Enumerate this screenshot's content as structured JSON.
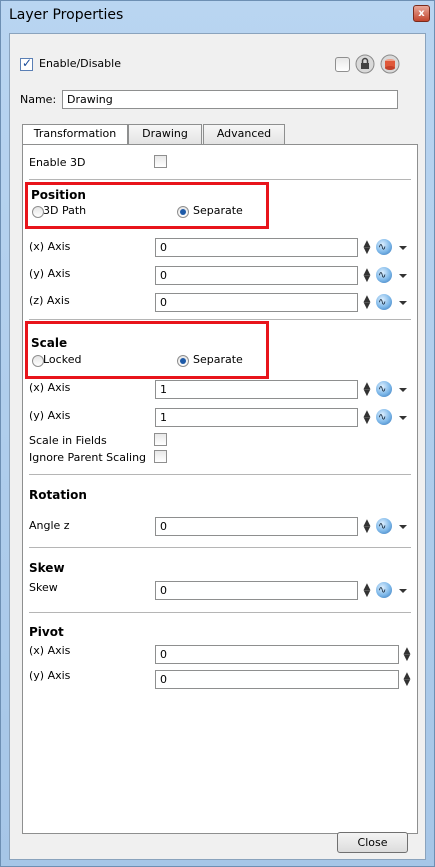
{
  "window": {
    "title": "Layer Properties"
  },
  "top": {
    "enable_label": "Enable/Disable",
    "name_label": "Name:",
    "name_value": "Drawing"
  },
  "tabs": [
    {
      "label": "Transformation"
    },
    {
      "label": "Drawing"
    },
    {
      "label": "Advanced"
    }
  ],
  "enable3d": {
    "label": "Enable 3D"
  },
  "position": {
    "title": "Position",
    "option_a": "3D Path",
    "option_b": "Separate",
    "rows": [
      {
        "label": "(x) Axis",
        "value": "0"
      },
      {
        "label": "(y) Axis",
        "value": "0"
      },
      {
        "label": "(z) Axis",
        "value": "0"
      }
    ]
  },
  "scale": {
    "title": "Scale",
    "option_a": "Locked",
    "option_b": "Separate",
    "rows": [
      {
        "label": "(x) Axis",
        "value": "1"
      },
      {
        "label": "(y) Axis",
        "value": "1"
      }
    ],
    "scale_in_fields": "Scale in Fields",
    "ignore_parent": "Ignore Parent Scaling"
  },
  "rotation": {
    "title": "Rotation",
    "label": "Angle z",
    "value": "0"
  },
  "skew": {
    "title": "Skew",
    "label": "Skew",
    "value": "0"
  },
  "pivot": {
    "title": "Pivot",
    "rows": [
      {
        "label": "(x) Axis",
        "value": "0"
      },
      {
        "label": "(y) Axis",
        "value": "0"
      }
    ]
  },
  "footer": {
    "close_label": "Close"
  },
  "colors": {
    "highlight": "#e8141b",
    "accent": "#1e5aa8"
  },
  "icons": [
    "close-icon",
    "lock-icon",
    "layer-color-icon",
    "function-icon",
    "dropdown-arrow-icon",
    "spin-arrows-icon"
  ]
}
